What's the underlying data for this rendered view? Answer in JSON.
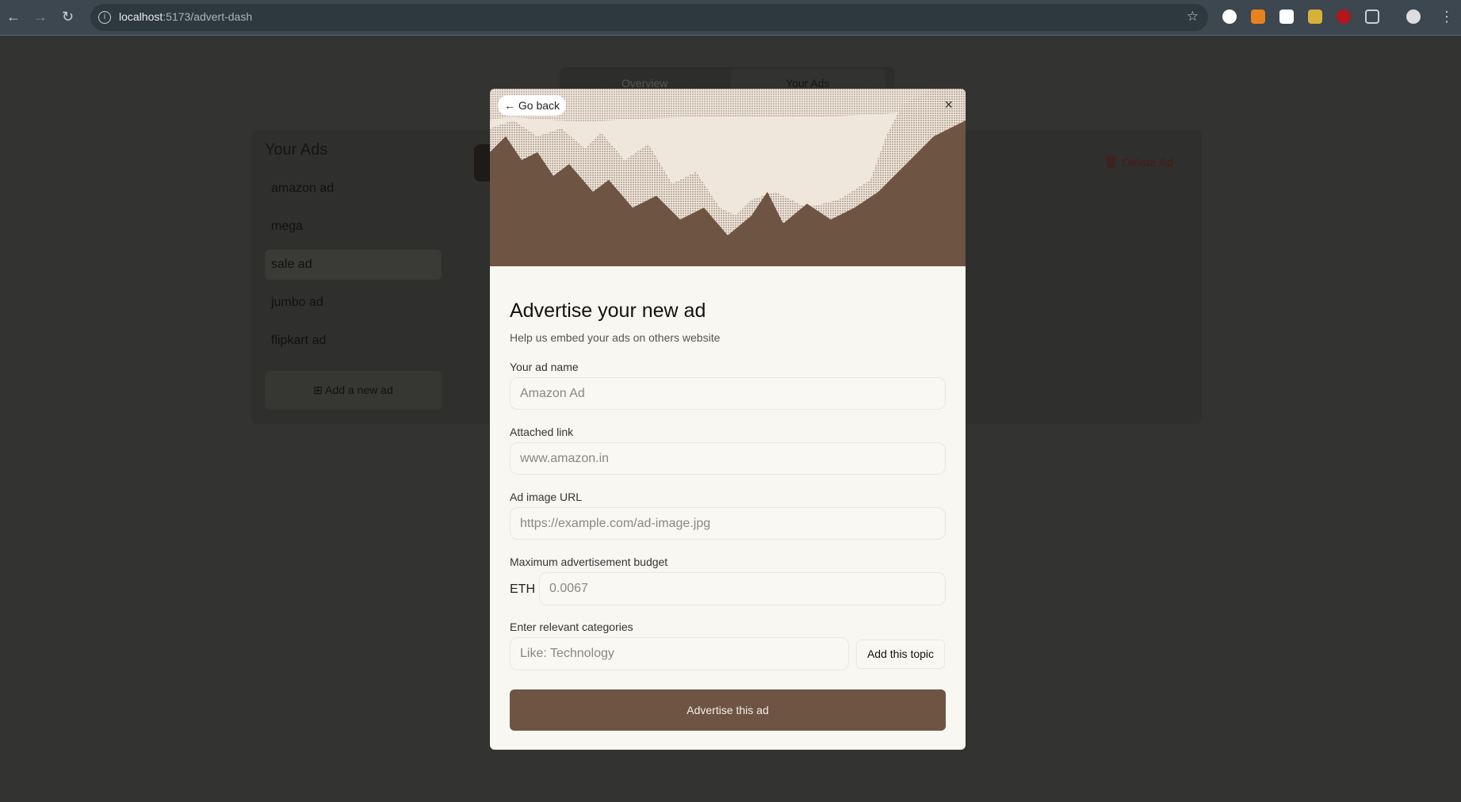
{
  "browser": {
    "url_host": "localhost",
    "url_path": ":5173/advert-dash"
  },
  "background": {
    "tabs": [
      "Overview",
      "Your Ads"
    ],
    "sidebar_title": "Your Ads",
    "ads": [
      "amazon ad",
      "mega",
      "sale ad",
      "jumbo ad",
      "flipkart ad"
    ],
    "selected_ad": "sale ad",
    "add_button": "Add a new ad",
    "delete_button": "Delete Ad"
  },
  "modal": {
    "go_back": "Go back",
    "close": "×",
    "title": "Advertise your new ad",
    "subtitle": "Help us embed your ads on others website",
    "fields": {
      "name": {
        "label": "Your ad name",
        "placeholder": "Amazon Ad"
      },
      "link": {
        "label": "Attached link",
        "placeholder": "www.amazon.in"
      },
      "image": {
        "label": "Ad image URL",
        "placeholder": "https://example.com/ad-image.jpg"
      },
      "budget": {
        "label": "Maximum advertisement budget",
        "currency": "ETH",
        "placeholder": "0.0067"
      },
      "categories": {
        "label": "Enter relevant categories",
        "placeholder": "Like: Technology",
        "add_button": "Add this topic"
      }
    },
    "submit": "Advertise this ad"
  },
  "colors": {
    "accent": "#6e5443",
    "overlay": "#333331",
    "modal_bg": "#f9f7f1",
    "delete": "#b3312c"
  }
}
